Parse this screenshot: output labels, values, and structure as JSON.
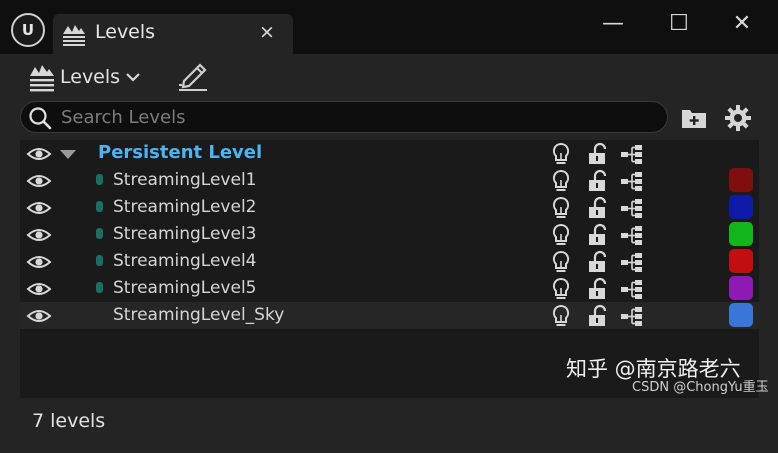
{
  "window": {
    "logo_text": "U",
    "tab_title": "Levels",
    "tab_close": "×",
    "minimize": "—",
    "maximize": "☐",
    "close": "✕"
  },
  "toolbar": {
    "levels_label": "Levels",
    "levels_icon": "levels-icon",
    "dropdown_icon": "chevron-down-icon",
    "edit_icon": "edit-pencil-icon"
  },
  "search": {
    "placeholder": "Search Levels",
    "value": ""
  },
  "levels": [
    {
      "name": "Persistent Level",
      "persistent": true,
      "color": ""
    },
    {
      "name": "StreamingLevel1",
      "persistent": false,
      "color": "#7f0e0e"
    },
    {
      "name": "StreamingLevel2",
      "persistent": false,
      "color": "#0f1aa8"
    },
    {
      "name": "StreamingLevel3",
      "persistent": false,
      "color": "#12b51a"
    },
    {
      "name": "StreamingLevel4",
      "persistent": false,
      "color": "#c20e0e"
    },
    {
      "name": "StreamingLevel5",
      "persistent": false,
      "color": "#8d1ab5"
    },
    {
      "name": "StreamingLevel_Sky",
      "persistent": false,
      "color": "#3a76d8"
    }
  ],
  "status": {
    "count_text": "7 levels"
  },
  "watermark": {
    "line1": "知乎 @南京路老六",
    "line2": "CSDN @ChongYu重玉"
  },
  "colors": {
    "accent_persistent": "#4fb3f2",
    "panel_bg": "#242424",
    "list_bg": "#1a1a1a"
  }
}
